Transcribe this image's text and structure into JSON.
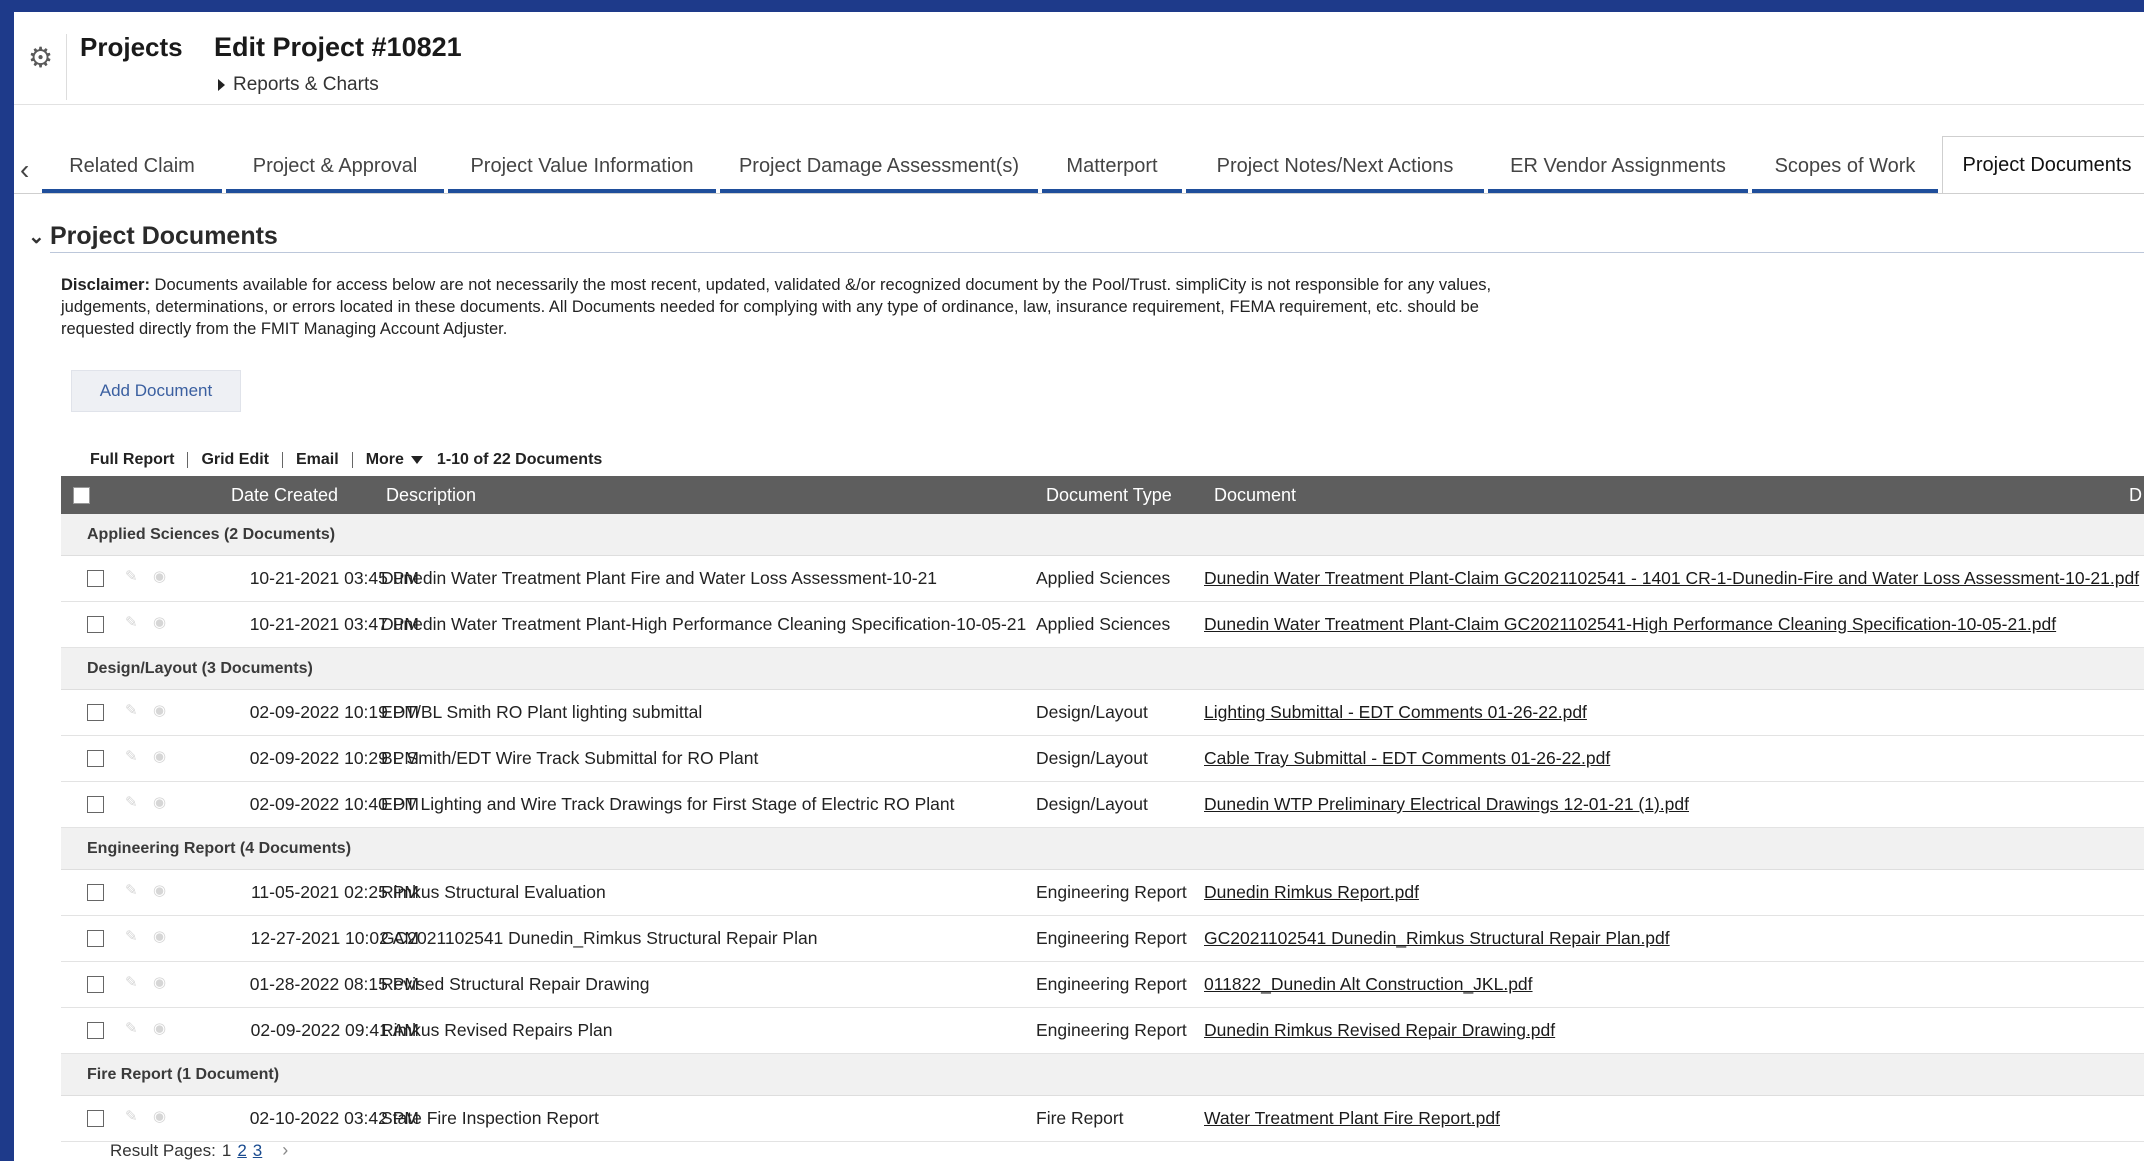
{
  "header": {
    "app_title": "Projects",
    "page_title": "Edit Project #10821",
    "submenu": "Reports & Charts"
  },
  "tabs": [
    {
      "label": "Related Claim"
    },
    {
      "label": "Project & Approval"
    },
    {
      "label": "Project Value Information"
    },
    {
      "label": "Project Damage Assessment(s)"
    },
    {
      "label": "Matterport"
    },
    {
      "label": "Project Notes/Next Actions"
    },
    {
      "label": "ER Vendor Assignments"
    },
    {
      "label": "Scopes of Work"
    },
    {
      "label": "Project Documents"
    }
  ],
  "section": {
    "title": "Project Documents",
    "disclaimer_label": "Disclaimer:",
    "disclaimer_text": " Documents available for access below are not necessarily the most recent, updated, validated &/or recognized document by the Pool/Trust. simpliCity is not responsible for any values, judgements, determinations, or errors located in these documents. All Documents needed for complying with any type of ordinance, law, insurance requirement, FEMA requirement, etc. should be requested directly from the FMIT Managing Account Adjuster.",
    "add_button": "Add Document"
  },
  "toolbar": {
    "full_report": "Full Report",
    "grid_edit": "Grid Edit",
    "email": "Email",
    "more": "More",
    "count": "1-10 of 22 Documents"
  },
  "table": {
    "headers": {
      "date": "Date Created",
      "description": "Description",
      "type": "Document Type",
      "document": "Document",
      "extra": "D"
    },
    "groups": [
      {
        "label": "Applied Sciences  (2 Documents)",
        "rows": [
          {
            "date": "10-21-2021 03:45 PM",
            "description": "Dunedin Water Treatment Plant Fire and Water Loss Assessment-10-21",
            "type": "Applied Sciences",
            "document": "Dunedin Water Treatment Plant-Claim GC2021102541 - 1401 CR-1-Dunedin-Fire and Water Loss Assessment-10-21.pdf"
          },
          {
            "date": "10-21-2021 03:47 PM",
            "description": "Dunedin Water Treatment Plant-High Performance Cleaning Specification-10-05-21",
            "type": "Applied Sciences",
            "document": "Dunedin Water Treatment Plant-Claim GC2021102541-High Performance Cleaning Specification-10-05-21.pdf"
          }
        ]
      },
      {
        "label": "Design/Layout  (3 Documents)",
        "rows": [
          {
            "date": "02-09-2022 10:19 PM",
            "description": "EDT/BL Smith RO Plant lighting submittal",
            "type": "Design/Layout",
            "document": "Lighting Submittal - EDT Comments 01-26-22.pdf"
          },
          {
            "date": "02-09-2022 10:29 PM",
            "description": "BL Smith/EDT Wire Track Submittal for RO Plant",
            "type": "Design/Layout",
            "document": "Cable Tray Submittal - EDT Comments 01-26-22.pdf"
          },
          {
            "date": "02-09-2022 10:40 PM",
            "description": "EDT Lighting and Wire Track Drawings for First Stage of Electric RO Plant",
            "type": "Design/Layout",
            "document": "Dunedin WTP Preliminary Electrical Drawings 12-01-21 (1).pdf"
          }
        ]
      },
      {
        "label": "Engineering Report  (4 Documents)",
        "rows": [
          {
            "date": "11-05-2021 02:25 PM",
            "description": "Rimkus Structural Evaluation",
            "type": "Engineering Report",
            "document": "Dunedin Rimkus Report.pdf"
          },
          {
            "date": "12-27-2021 10:02 AM",
            "description": "GC2021102541 Dunedin_Rimkus Structural Repair Plan",
            "type": "Engineering Report",
            "document": "GC2021102541 Dunedin_Rimkus Structural Repair Plan.pdf"
          },
          {
            "date": "01-28-2022 08:15 PM",
            "description": "Revised Structural Repair Drawing",
            "type": "Engineering Report",
            "document": "011822_Dunedin Alt Construction_JKL.pdf"
          },
          {
            "date": "02-09-2022 09:41 AM",
            "description": "Rimkus Revised Repairs Plan",
            "type": "Engineering Report",
            "document": "Dunedin Rimkus Revised Repair Drawing.pdf"
          }
        ]
      },
      {
        "label": "Fire Report  (1 Document)",
        "rows": [
          {
            "date": "02-10-2022 03:42 PM",
            "description": "State Fire Inspection Report",
            "type": "Fire Report",
            "document": "Water Treatment Plant Fire Report.pdf"
          }
        ]
      }
    ]
  },
  "pager": {
    "label": "Result Pages:",
    "pages": [
      "1",
      "2",
      "3"
    ],
    "next": "›"
  },
  "icons": {
    "gear": "gear-icon",
    "tabs_prev": "chevron-left-icon",
    "collapse": "chevron-down-icon",
    "row_edit": "pencil-icon",
    "row_view": "eye-icon"
  }
}
